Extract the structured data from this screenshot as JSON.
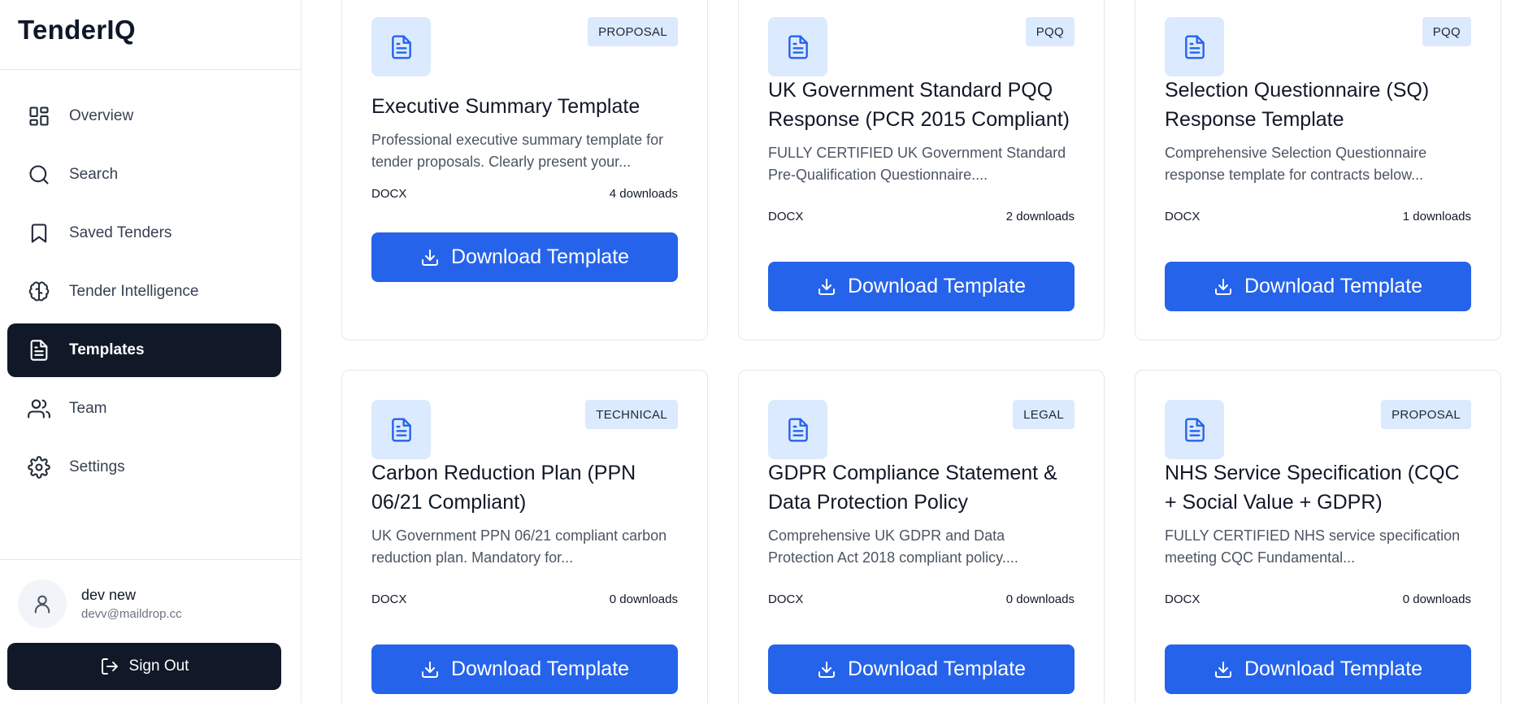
{
  "app": {
    "brand": "TenderIQ"
  },
  "sidebar": {
    "items": [
      {
        "label": "Overview",
        "icon": "layout-dashboard-icon",
        "active": false
      },
      {
        "label": "Search",
        "icon": "search-icon",
        "active": false
      },
      {
        "label": "Saved Tenders",
        "icon": "bookmark-icon",
        "active": false
      },
      {
        "label": "Tender Intelligence",
        "icon": "brain-icon",
        "active": false
      },
      {
        "label": "Templates",
        "icon": "file-text-icon",
        "active": true
      },
      {
        "label": "Team",
        "icon": "users-icon",
        "active": false
      },
      {
        "label": "Settings",
        "icon": "gear-icon",
        "active": false
      }
    ],
    "user": {
      "name": "dev new",
      "email": "devv@maildrop.cc",
      "icon": "user-icon"
    },
    "signout_label": "Sign Out"
  },
  "colors": {
    "accent": "#2563eb",
    "dark": "#111827",
    "badge_bg": "#dbeafe"
  },
  "templates": [
    {
      "badge": "PROPOSAL",
      "title": "Executive Summary Template",
      "description": "Professional executive summary template for tender proposals. Clearly present your...",
      "format": "DOCX",
      "downloads": "4 downloads",
      "button": "Download Template"
    },
    {
      "badge": "PQQ",
      "title": "UK Government Standard PQQ Response (PCR 2015 Compliant)",
      "description": "FULLY CERTIFIED UK Government Standard Pre-Qualification Questionnaire....",
      "format": "DOCX",
      "downloads": "2 downloads",
      "button": "Download Template"
    },
    {
      "badge": "PQQ",
      "title": "Selection Questionnaire (SQ) Response Template",
      "description": "Comprehensive Selection Questionnaire response template for contracts below...",
      "format": "DOCX",
      "downloads": "1 downloads",
      "button": "Download Template"
    },
    {
      "badge": "TECHNICAL",
      "title": "Carbon Reduction Plan (PPN 06/21 Compliant)",
      "description": "UK Government PPN 06/21 compliant carbon reduction plan. Mandatory for...",
      "format": "DOCX",
      "downloads": "0 downloads",
      "button": "Download Template"
    },
    {
      "badge": "LEGAL",
      "title": "GDPR Compliance Statement & Data Protection Policy",
      "description": "Comprehensive UK GDPR and Data Protection Act 2018 compliant policy....",
      "format": "DOCX",
      "downloads": "0 downloads",
      "button": "Download Template"
    },
    {
      "badge": "PROPOSAL",
      "title": "NHS Service Specification (CQC + Social Value + GDPR)",
      "description": "FULLY CERTIFIED NHS service specification meeting CQC Fundamental...",
      "format": "DOCX",
      "downloads": "0 downloads",
      "button": "Download Template"
    }
  ]
}
